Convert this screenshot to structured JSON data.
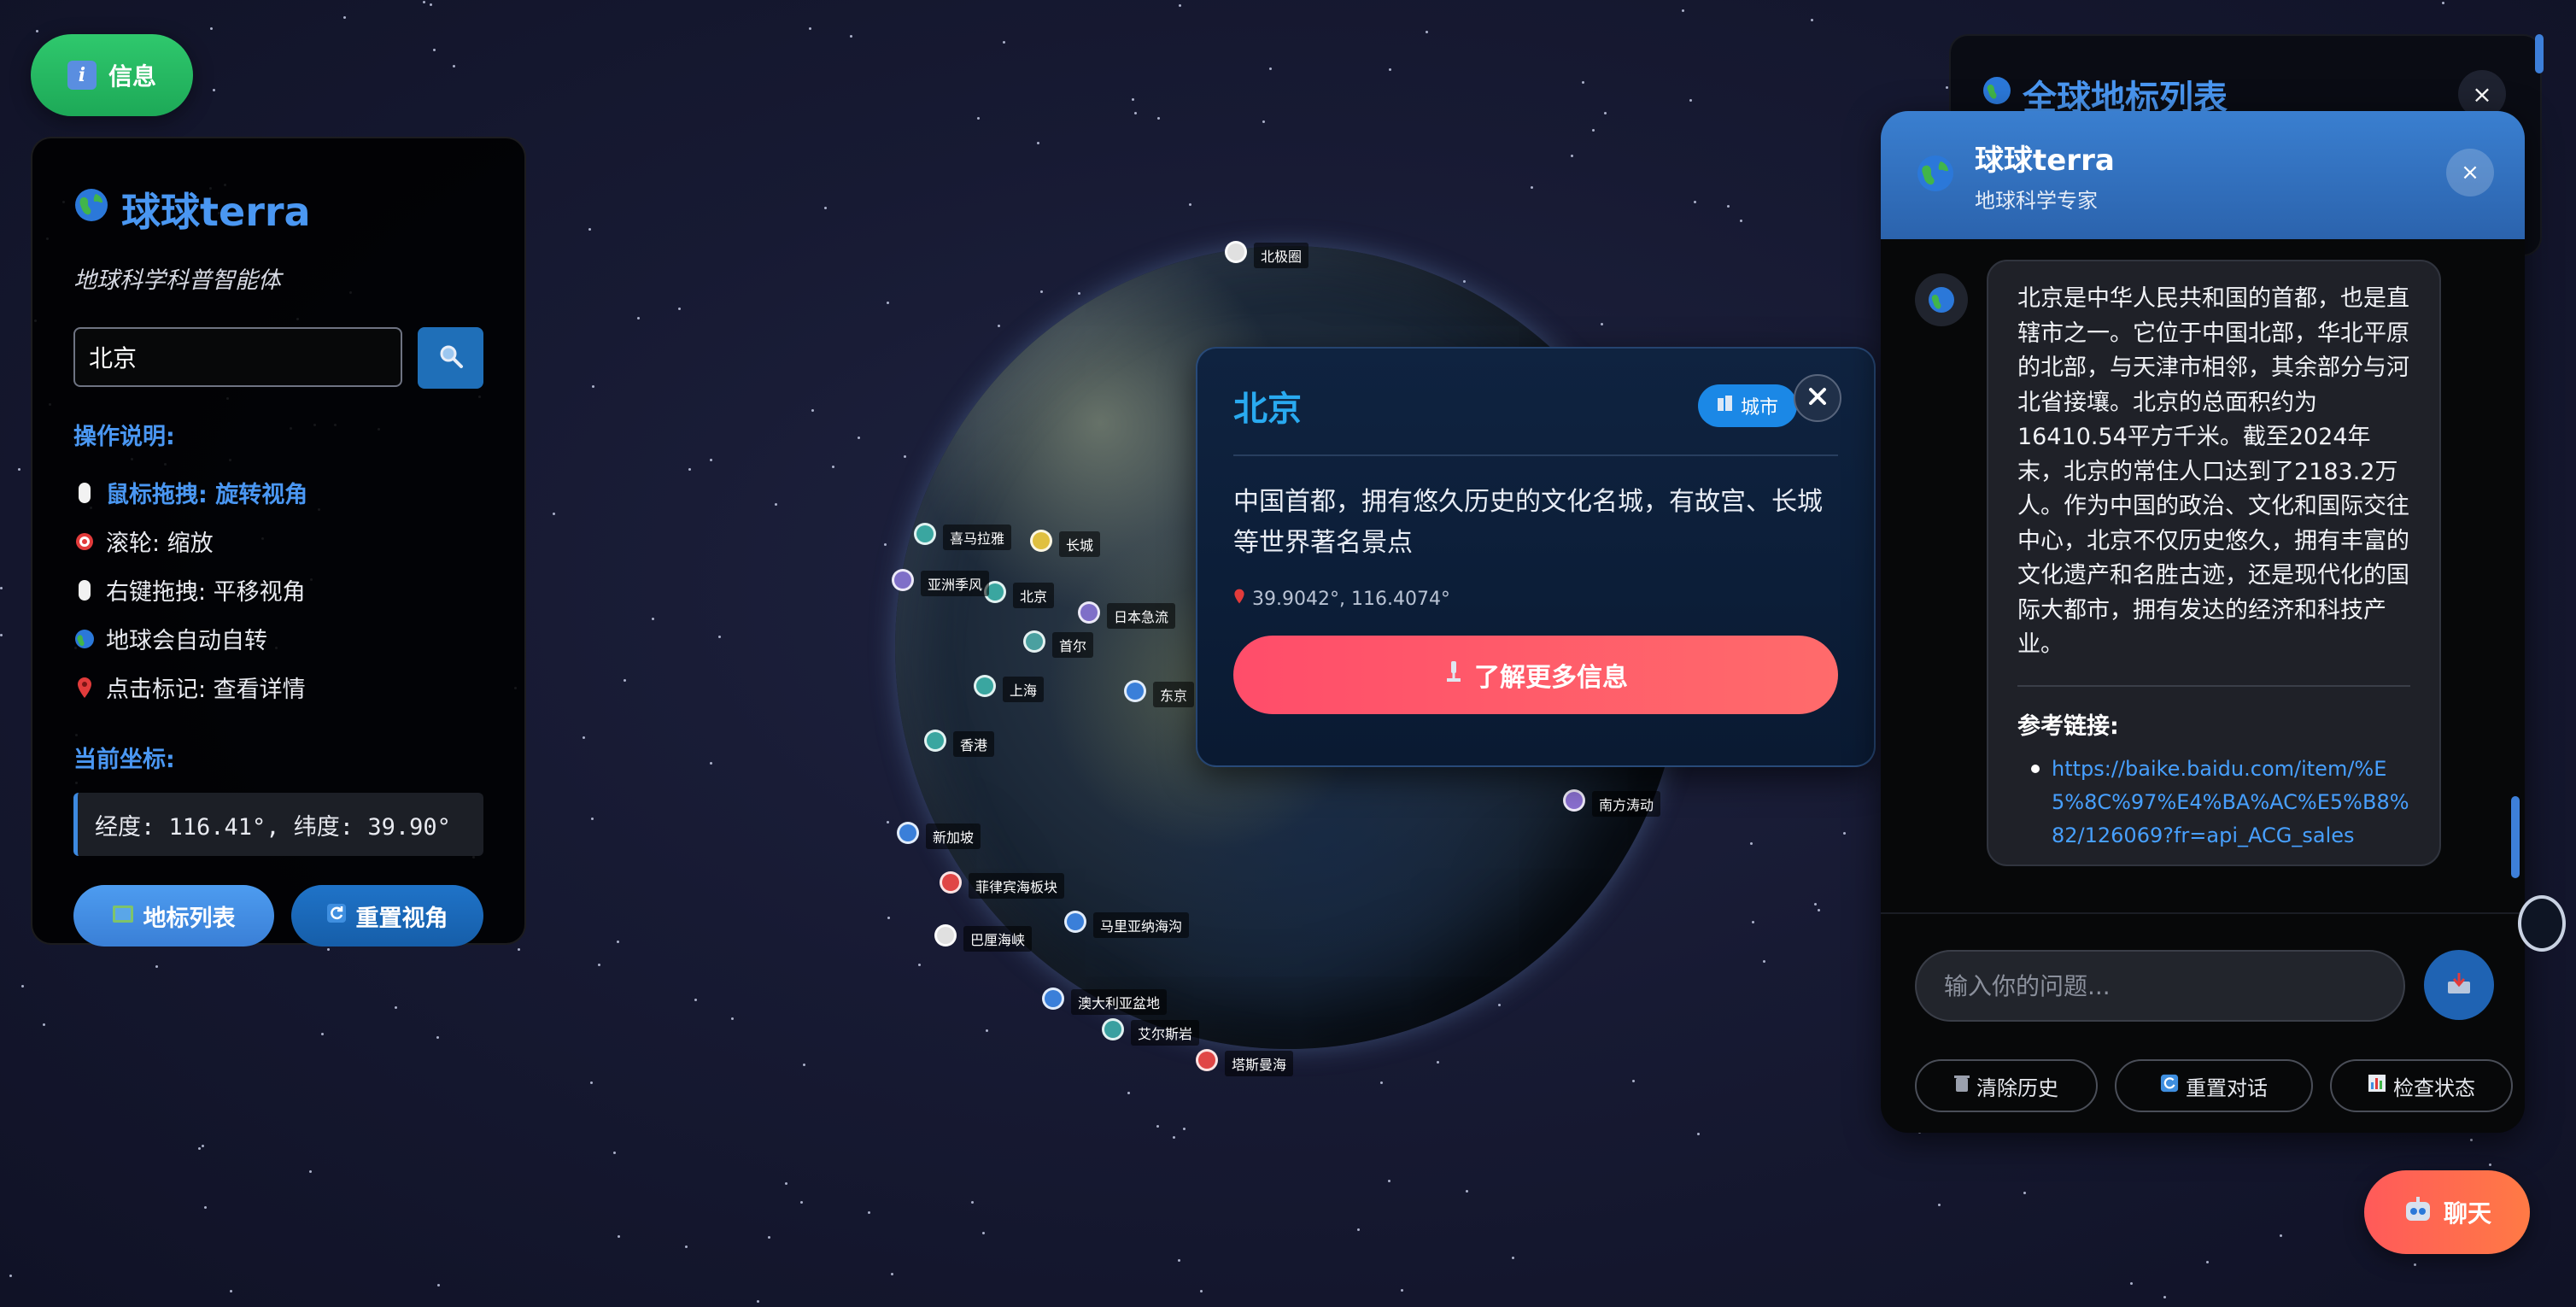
{
  "info_button": {
    "label": "信息"
  },
  "left_panel": {
    "title": "球球terra",
    "subtitle": "地球科学科普智能体",
    "search": {
      "value": "北京",
      "placeholder": ""
    },
    "instructions_heading": "操作说明:",
    "instructions": [
      {
        "text": "鼠标拖拽: 旋转视角",
        "icon": "mouse-icon"
      },
      {
        "text": "滚轮: 缩放",
        "icon": "target-icon"
      },
      {
        "text": "右键拖拽: 平移视角",
        "icon": "mouse-icon"
      },
      {
        "text": "地球会自动自转",
        "icon": "globe-icon"
      },
      {
        "text": "点击标记: 查看详情",
        "icon": "pin-icon"
      }
    ],
    "coords_heading": "当前坐标:",
    "coords_value": "经度: 116.41°, 纬度: 39.90°",
    "buttons": {
      "landmark_list": "地标列表",
      "reset_view": "重置视角"
    }
  },
  "globe_markers": [
    "长城",
    "北京",
    "日本急流",
    "首尔",
    "上海",
    "东京",
    "香港",
    "新加坡",
    "菲律宾海板块",
    "巴厘海峡",
    "马里亚纳海沟",
    "南方涛动",
    "喜马拉雅",
    "亚洲季风",
    "北极圈",
    "澳大利亚盆地",
    "艾尔斯岩",
    "塔斯曼海"
  ],
  "popup": {
    "title": "北京",
    "badge": "城市",
    "description": "中国首都，拥有悠久历史的文化名城，有故宫、长城等世界著名景点",
    "coords": "39.9042°, 116.4074°",
    "more_button": "了解更多信息"
  },
  "landmark_list_panel": {
    "title": "全球地标列表"
  },
  "chat": {
    "title": "球球terra",
    "subtitle": "地球科学专家",
    "message": "北京是中华人民共和国的首都，也是直辖市之一。它位于中国北部，华北平原的北部，与天津市相邻，其余部分与河北省接壤。北京的总面积约为16410.54平方千米。截至2024年末，北京的常住人口达到了2183.2万人。作为中国的政治、文化和国际交往中心，北京不仅历史悠久，拥有丰富的文化遗产和名胜古迹，还是现代化的国际大都市，拥有发达的经济和科技产业。",
    "ref_heading": "参考链接:",
    "ref_link": "https://baike.baidu.com/item/%E5%8C%97%E4%BA%AC%E5%B8%82/126069?fr=api_ACG_sales",
    "input_placeholder": "输入你的问题...",
    "actions": {
      "clear": "清除历史",
      "reset": "重置对话",
      "status": "检查状态"
    }
  },
  "chat_fab": {
    "label": "聊天"
  },
  "colors": {
    "accent_blue": "#4a97f2",
    "green": "#2fc86d",
    "red": "#ff4d6a",
    "popup_bg": "#0f2340"
  }
}
